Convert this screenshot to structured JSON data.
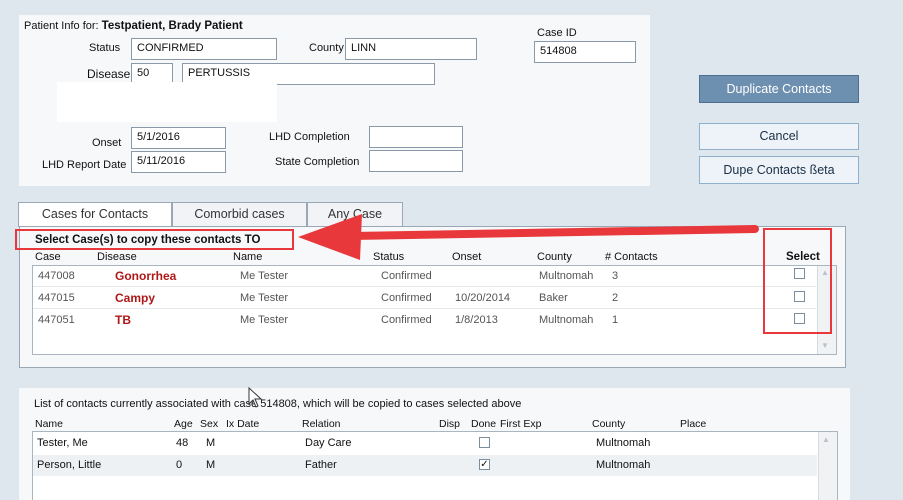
{
  "patient": {
    "header_label": "Patient Info for:",
    "name": "Testpatient, Brady Patient",
    "status_label": "Status",
    "status_value": "CONFIRMED",
    "county_label": "County",
    "county_value": "LINN",
    "case_id_label": "Case ID",
    "case_id_value": "514808",
    "disease_label": "Disease",
    "disease_code": "50",
    "disease_name": "PERTUSSIS",
    "onset_label": "Onset",
    "onset_value": "5/1/2016",
    "lhd_report_label": "LHD Report Date",
    "lhd_report_value": "5/11/2016",
    "lhd_completion_label": "LHD Completion",
    "lhd_completion_value": "",
    "state_completion_label": "State Completion",
    "state_completion_value": ""
  },
  "actions": {
    "duplicate": "Duplicate Contacts",
    "cancel": "Cancel",
    "dupe_beta": "Dupe Contacts ßeta"
  },
  "tabs": [
    {
      "label": "Cases for Contacts"
    },
    {
      "label": "Comorbid cases"
    },
    {
      "label": "Any Case"
    }
  ],
  "cases": {
    "instruction": "Select Case(s) to copy these contacts TO",
    "headers": {
      "case": "Case",
      "disease": "Disease",
      "name": "Name",
      "status": "Status",
      "onset": "Onset",
      "county": "County",
      "contacts": "# Contacts",
      "select": "Select"
    },
    "rows": [
      {
        "case": "447008",
        "disease": "Gonorrhea",
        "name": "Me Tester",
        "status": "Confirmed",
        "onset": "",
        "county": "Multnomah",
        "contacts": "3",
        "selected": false
      },
      {
        "case": "447015",
        "disease": "Campy",
        "name": "Me Tester",
        "status": "Confirmed",
        "onset": "10/20/2014",
        "county": "Baker",
        "contacts": "2",
        "selected": false
      },
      {
        "case": "447051",
        "disease": "TB",
        "name": "Me Tester",
        "status": "Confirmed",
        "onset": "1/8/2013",
        "county": "Multnomah",
        "contacts": "1",
        "selected": false
      }
    ]
  },
  "contacts": {
    "caption": "List of contacts currently associated with case 514808, which will be copied to cases selected above",
    "headers": {
      "name": "Name",
      "age": "Age",
      "sex": "Sex",
      "ix_date": "Ix Date",
      "relation": "Relation",
      "disp": "Disp",
      "done": "Done",
      "first_exp": "First Exp",
      "county": "County",
      "place": "Place"
    },
    "rows": [
      {
        "name": "Tester, Me",
        "age": "48",
        "sex": "M",
        "ix_date": "",
        "relation": "Day Care",
        "done": false,
        "done_glyph": "",
        "county": "Multnomah"
      },
      {
        "name": "Person, Little",
        "age": "0",
        "sex": "M",
        "ix_date": "",
        "relation": "Father",
        "done": true,
        "done_glyph": "✓",
        "county": "Multnomah"
      }
    ]
  },
  "icons": {
    "scroll_up": "▲",
    "scroll_down": "▼",
    "arrow": "red-arrow-annotation",
    "cursor": "mouse-pointer"
  },
  "colors": {
    "annotation_red": "#e8383b",
    "disease_red": "#b01818",
    "primary_button": "#6e90b0",
    "background": "#dfe7ee"
  }
}
